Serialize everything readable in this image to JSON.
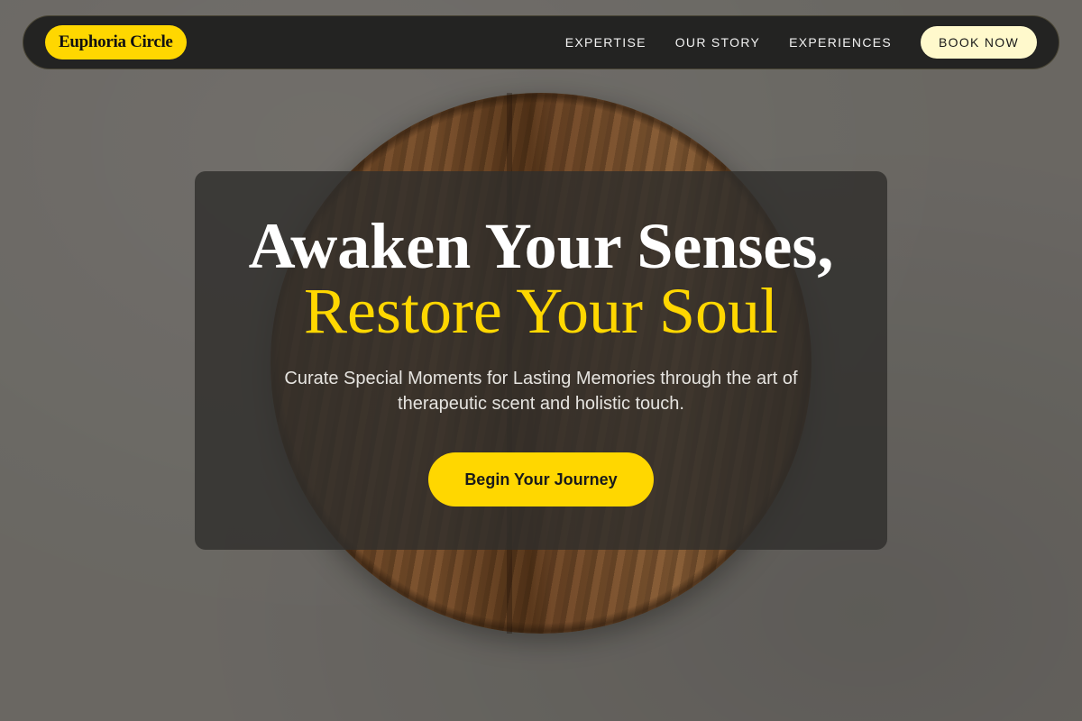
{
  "brand": {
    "name": "Euphoria Circle"
  },
  "nav": {
    "links": [
      "EXPERTISE",
      "OUR STORY",
      "EXPERIENCES"
    ],
    "book_label": "BOOK NOW"
  },
  "hero": {
    "line1": "Awaken Your Senses,",
    "line2": "Restore Your Soul",
    "subtitle": "Curate Special Moments for Lasting Memories through the art of therapeutic scent and holistic touch.",
    "cta_label": "Begin Your Journey"
  },
  "colors": {
    "accent": "#ffd700",
    "nav_bg": "#232322",
    "book_bg": "#fff9cc"
  }
}
